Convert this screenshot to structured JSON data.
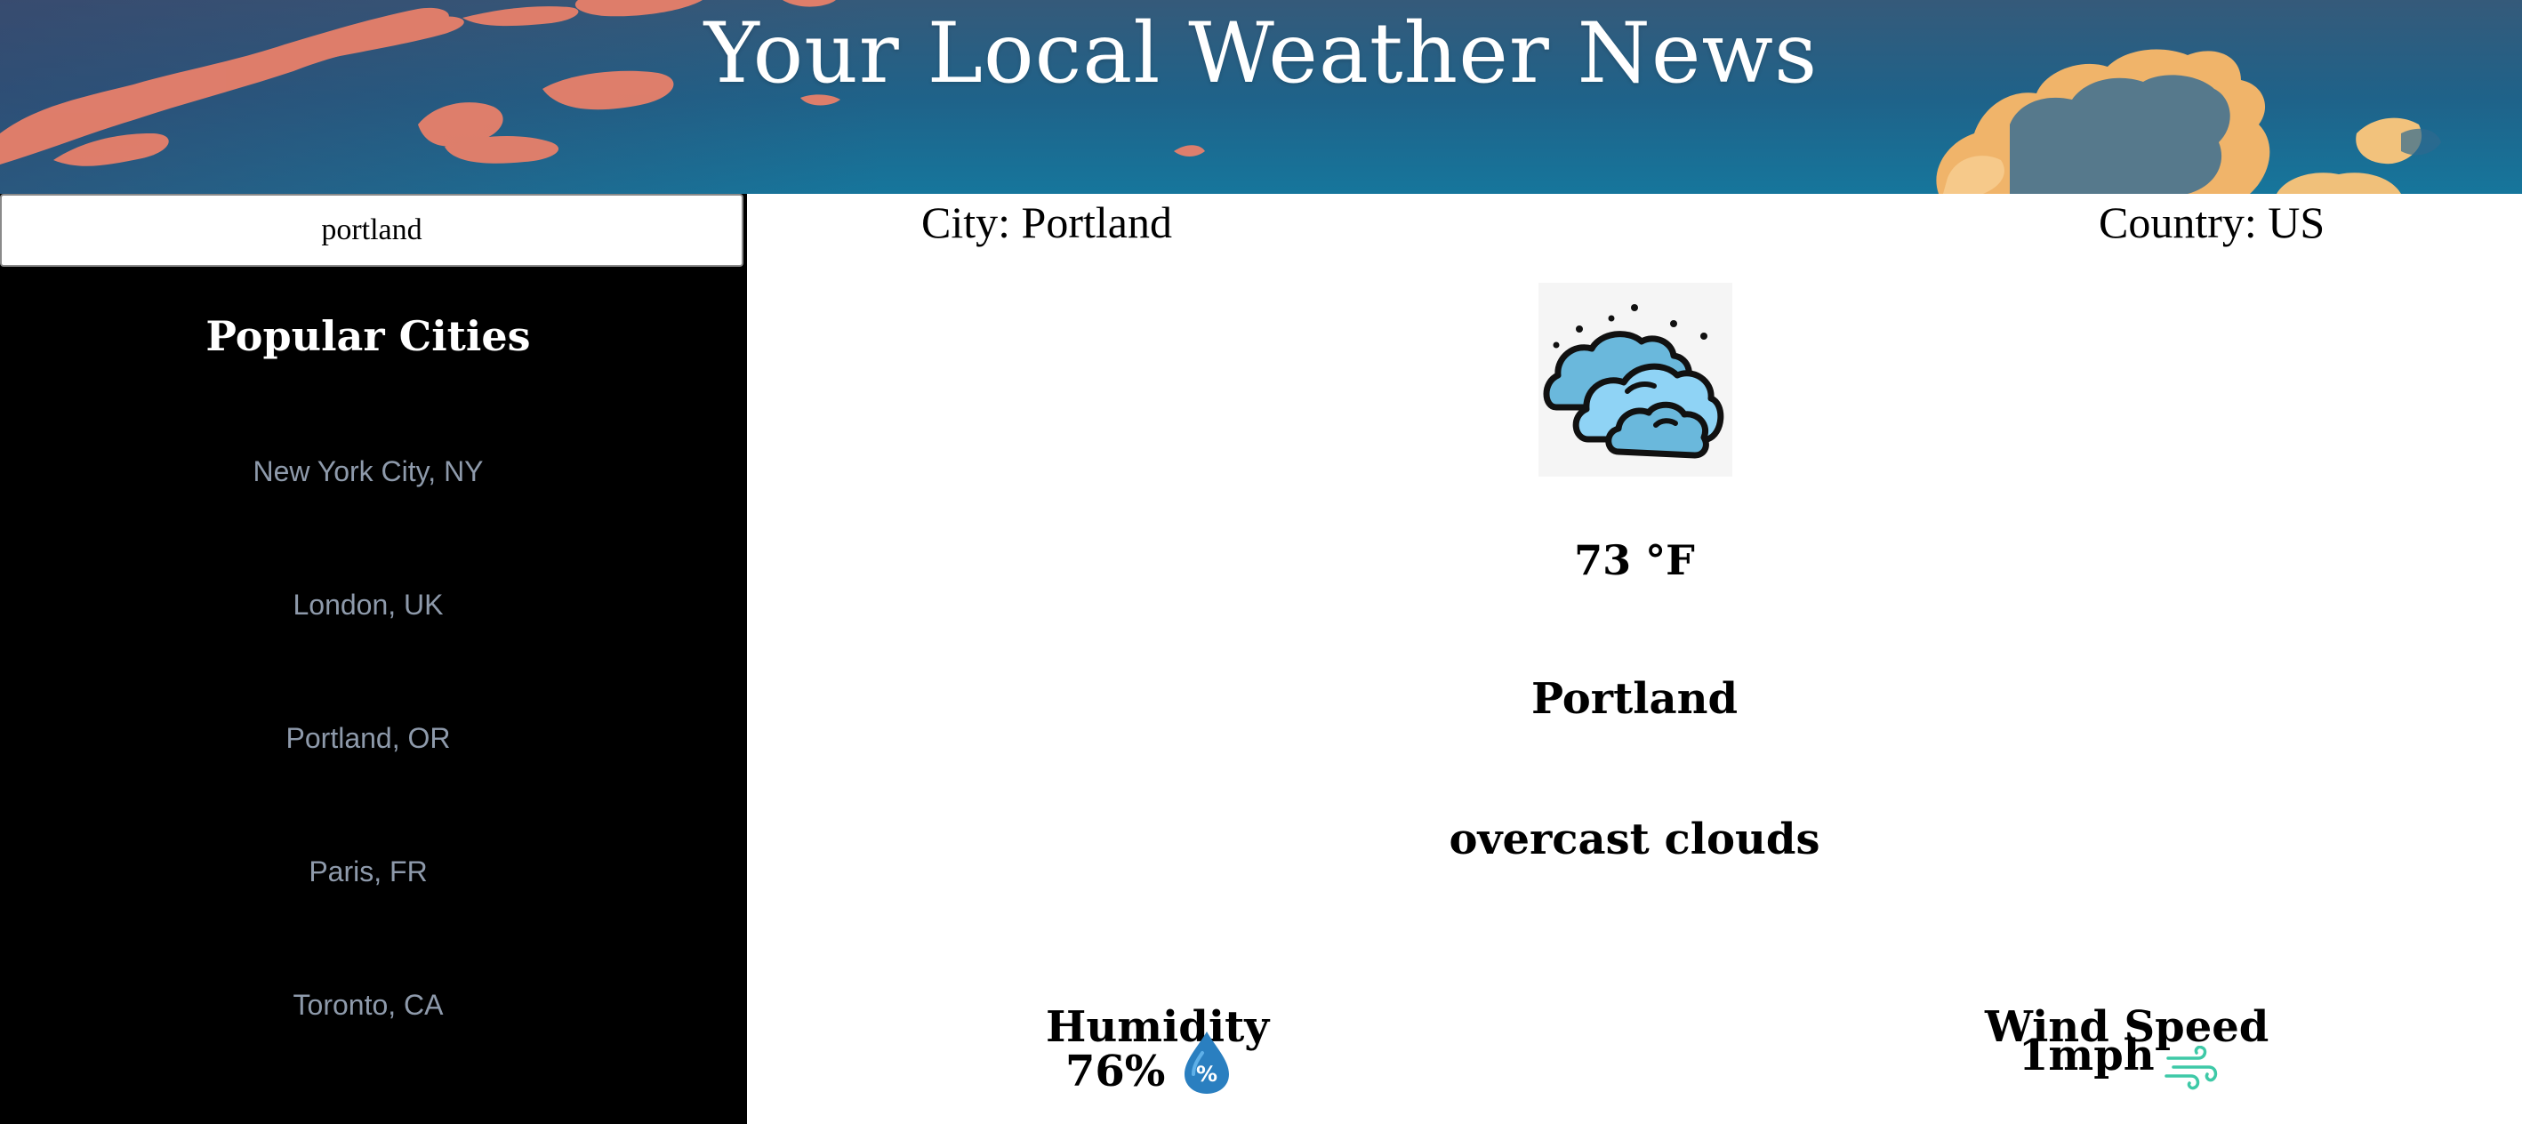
{
  "header": {
    "title": "Your Local Weather News"
  },
  "search": {
    "value": "portland"
  },
  "sidebar": {
    "heading": "Popular Cities",
    "cities": [
      "New York City, NY",
      "London, UK",
      "Portland, OR",
      "Paris, FR",
      "Toronto, CA"
    ]
  },
  "weather": {
    "city_label": "City: Portland",
    "country_label": "Country: US",
    "icon": "overcast-clouds-icon",
    "temperature": "73 °F",
    "city_name": "Portland",
    "description": "overcast clouds",
    "humidity_label": "Humidity",
    "humidity_value": "76%",
    "humidity_icon_text": "%",
    "wind_label": "Wind Speed",
    "wind_value": "1mph"
  },
  "colors": {
    "sidebar_bg": "#000000",
    "city_link": "#8e9aab",
    "sky": "#1d5f86",
    "cloud_pink": "#e8806a",
    "humidity_drop": "#2a7fc0",
    "wind_icon": "#3ec9a7"
  }
}
